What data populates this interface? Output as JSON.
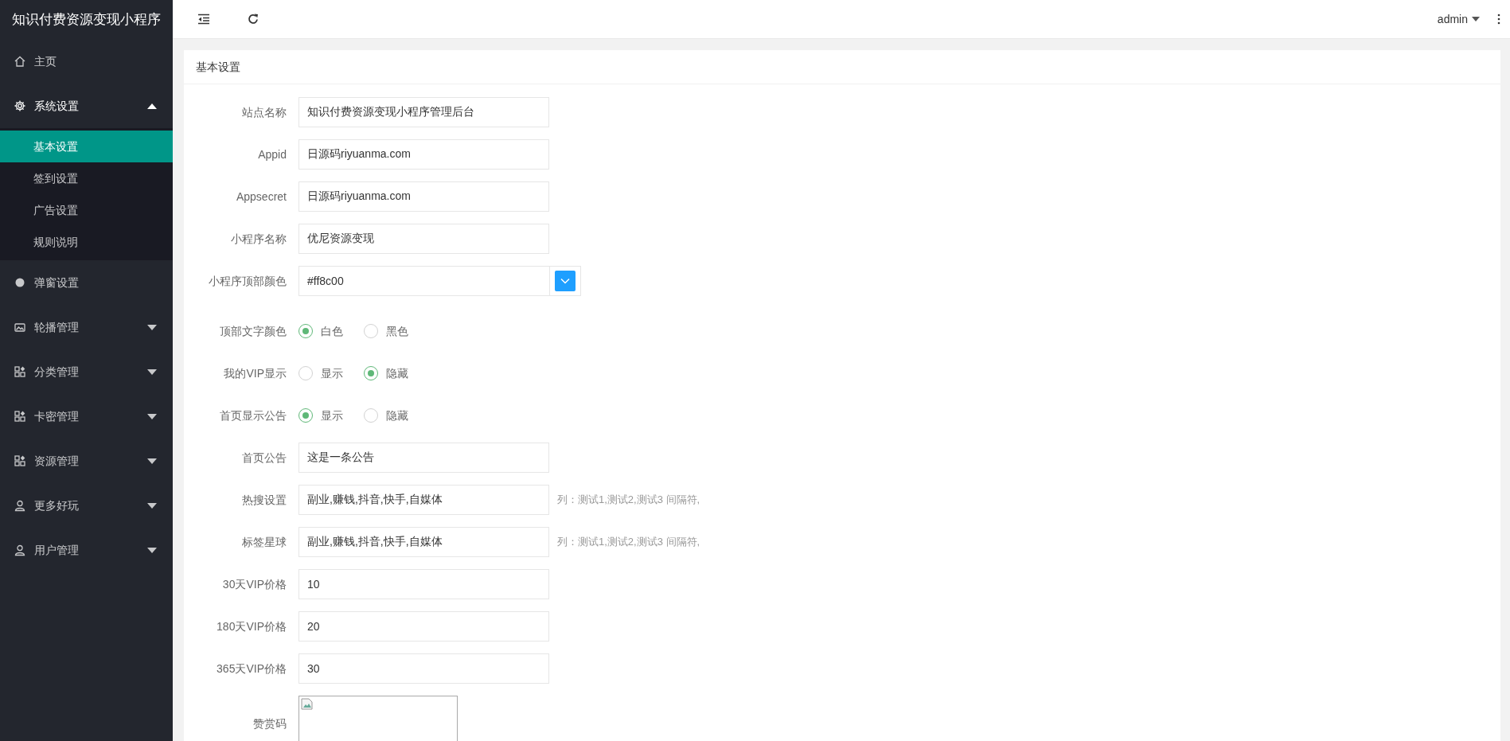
{
  "app_title": "知识付费资源变现小程序",
  "sidebar": {
    "items": [
      {
        "kind": "home",
        "label": "主页"
      },
      {
        "kind": "gear",
        "label": "系统设置",
        "expanded": true,
        "children": [
          {
            "label": "基本设置",
            "selected": true
          },
          {
            "label": "签到设置",
            "selected": false
          },
          {
            "label": "广告设置",
            "selected": false
          },
          {
            "label": "规则说明",
            "selected": false
          }
        ]
      },
      {
        "kind": "dot",
        "label": "弹窗设置"
      },
      {
        "kind": "image",
        "label": "轮播管理",
        "expanded": false
      },
      {
        "kind": "grid",
        "label": "分类管理",
        "expanded": false
      },
      {
        "kind": "grid",
        "label": "卡密管理",
        "expanded": false
      },
      {
        "kind": "grid",
        "label": "资源管理",
        "expanded": false
      },
      {
        "kind": "user",
        "label": "更多好玩",
        "expanded": false
      },
      {
        "kind": "user",
        "label": "用户管理",
        "expanded": false
      }
    ]
  },
  "header": {
    "user": "admin"
  },
  "card": {
    "title": "基本设置",
    "fields": [
      {
        "kind": "text",
        "label": "站点名称",
        "value": "知识付费资源变现小程序管理后台"
      },
      {
        "kind": "text",
        "label": "Appid",
        "value": "日源码riyuanma.com"
      },
      {
        "kind": "text",
        "label": "Appsecret",
        "value": "日源码riyuanma.com"
      },
      {
        "kind": "text",
        "label": "小程序名称",
        "value": "优尼资源变现"
      },
      {
        "kind": "color",
        "label": "小程序顶部颜色",
        "value": "#ff8c00"
      },
      {
        "kind": "radio",
        "label": "顶部文字颜色",
        "options": [
          {
            "label": "白色",
            "selected": true
          },
          {
            "label": "黑色",
            "selected": false
          }
        ]
      },
      {
        "kind": "radio",
        "label": "我的VIP显示",
        "options": [
          {
            "label": "显示",
            "selected": false
          },
          {
            "label": "隐藏",
            "selected": true
          }
        ]
      },
      {
        "kind": "radio",
        "label": "首页显示公告",
        "options": [
          {
            "label": "显示",
            "selected": true
          },
          {
            "label": "隐藏",
            "selected": false
          }
        ]
      },
      {
        "kind": "text",
        "label": "首页公告",
        "value": "这是一条公告"
      },
      {
        "kind": "text",
        "label": "热搜设置",
        "value": "副业,赚钱,抖音,快手,自媒体",
        "hint": "列：测试1,测试2,测试3 间隔符,"
      },
      {
        "kind": "text",
        "label": "标签星球",
        "value": "副业,赚钱,抖音,快手,自媒体",
        "hint": "列：测试1,测试2,测试3 间隔符,"
      },
      {
        "kind": "text",
        "label": "30天VIP价格",
        "value": "10"
      },
      {
        "kind": "text",
        "label": "180天VIP价格",
        "value": "20"
      },
      {
        "kind": "text",
        "label": "365天VIP价格",
        "value": "30"
      },
      {
        "kind": "image",
        "label": "赞赏码"
      }
    ]
  }
}
